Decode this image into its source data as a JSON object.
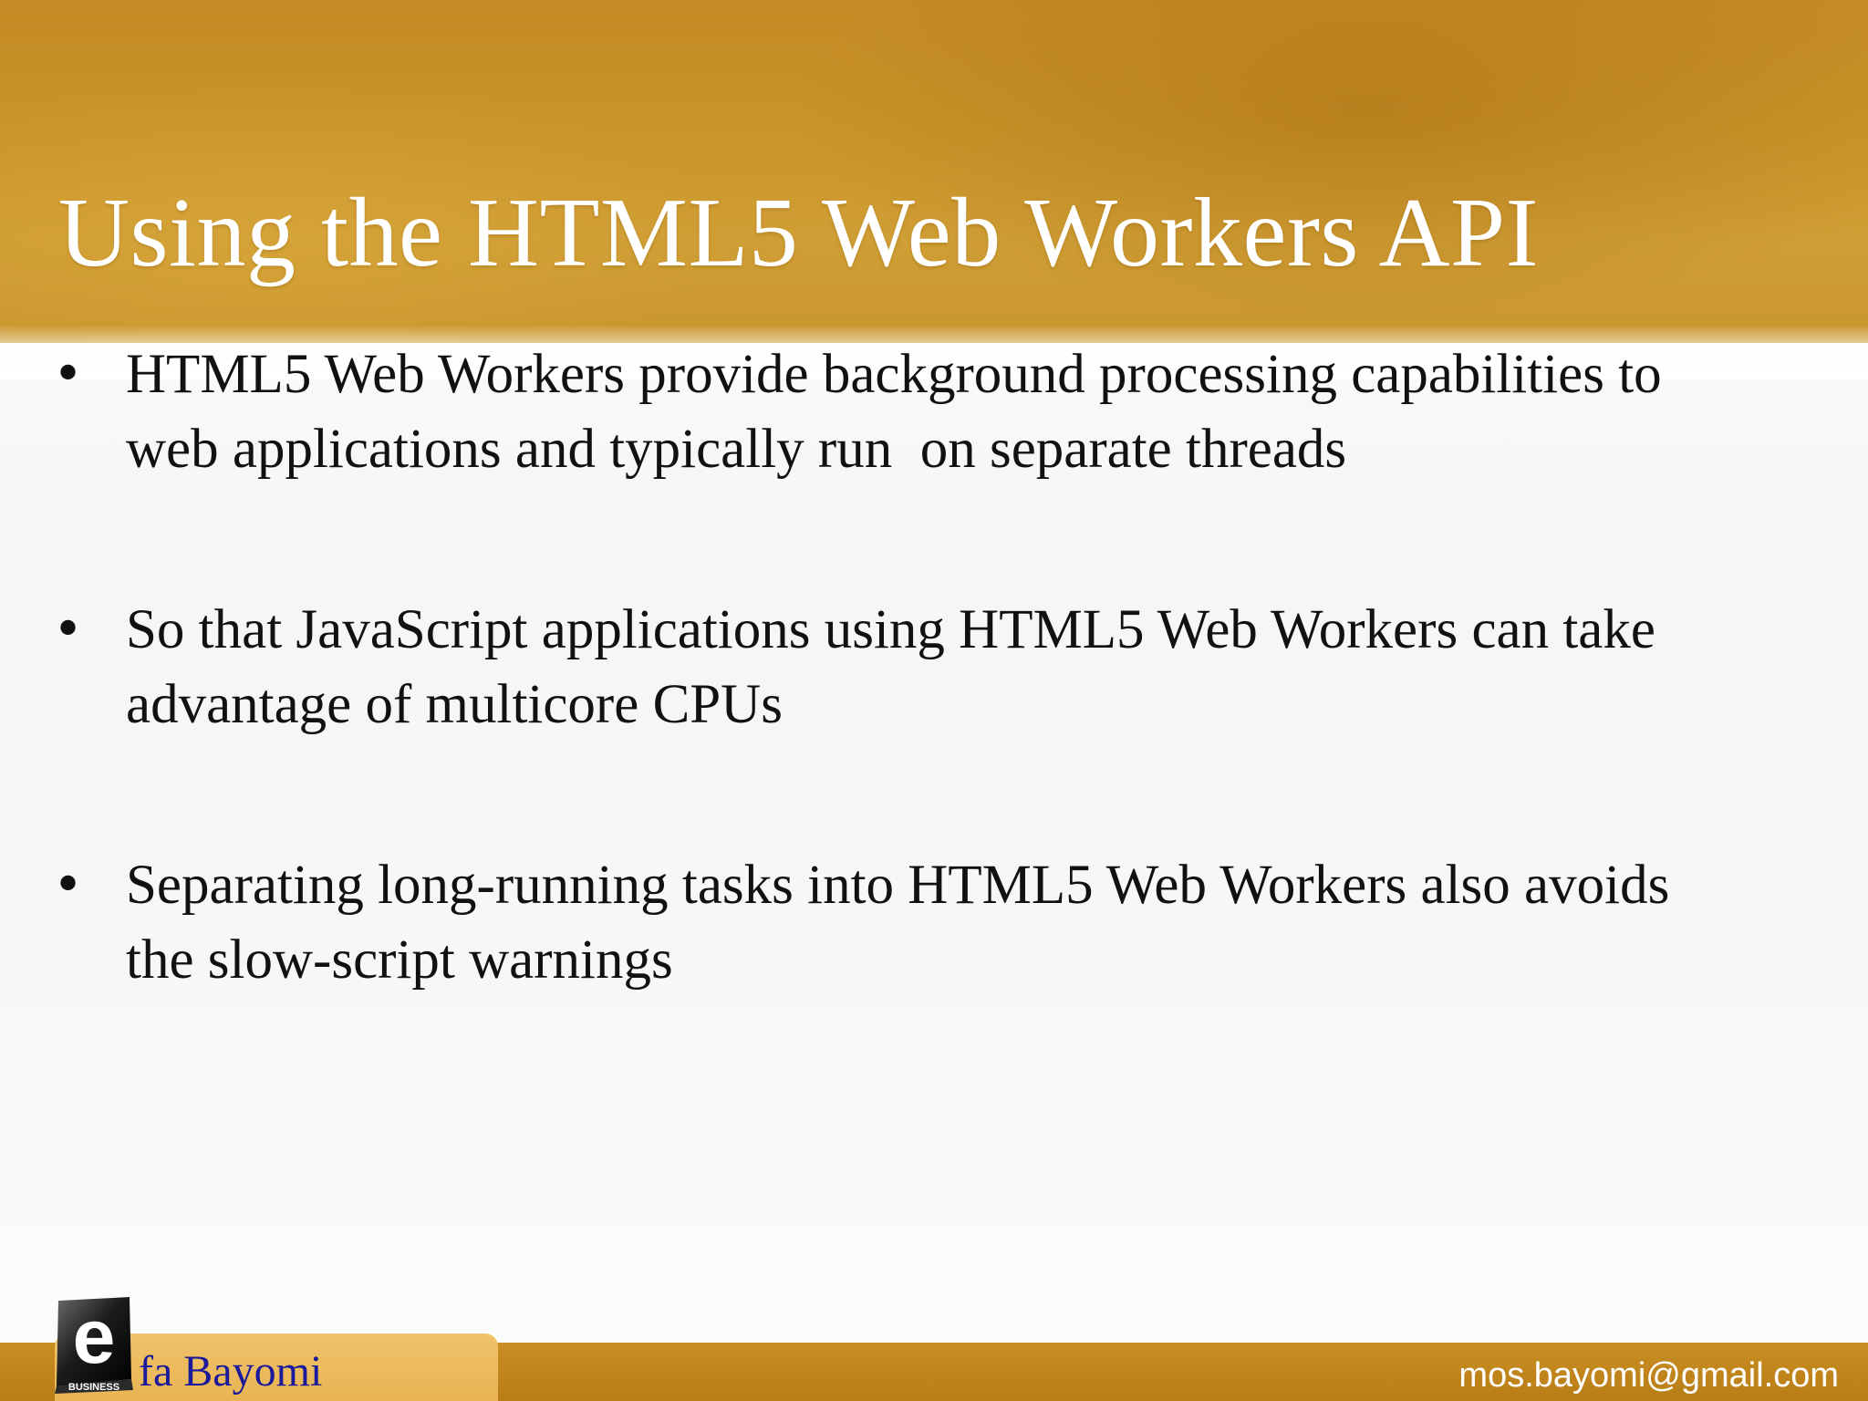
{
  "slide": {
    "title": "Using the HTML5 Web Workers API",
    "bullets": [
      "HTML5 Web Workers provide background processing capabilities to\nweb applications and typically run  on separate threads",
      "So that JavaScript applications using HTML5 Web Workers can take\nadvantage of multicore CPUs",
      "Separating long-running tasks into HTML5 Web Workers also avoids\nthe slow-script warnings"
    ],
    "bullet_glyph": "•"
  },
  "footer": {
    "author": "fa Bayomi",
    "email": "mos.bayomi@gmail.com",
    "logo_letter": "e",
    "logo_caption": "BUSINESS"
  },
  "colors": {
    "header_gold": "#c99428",
    "footer_gold": "#b97d16",
    "footer_tab": "#f0c36a",
    "author_text": "#1a1a9a",
    "body_text": "#111111"
  },
  "icons": {
    "logo": "e-business-logo-icon"
  }
}
